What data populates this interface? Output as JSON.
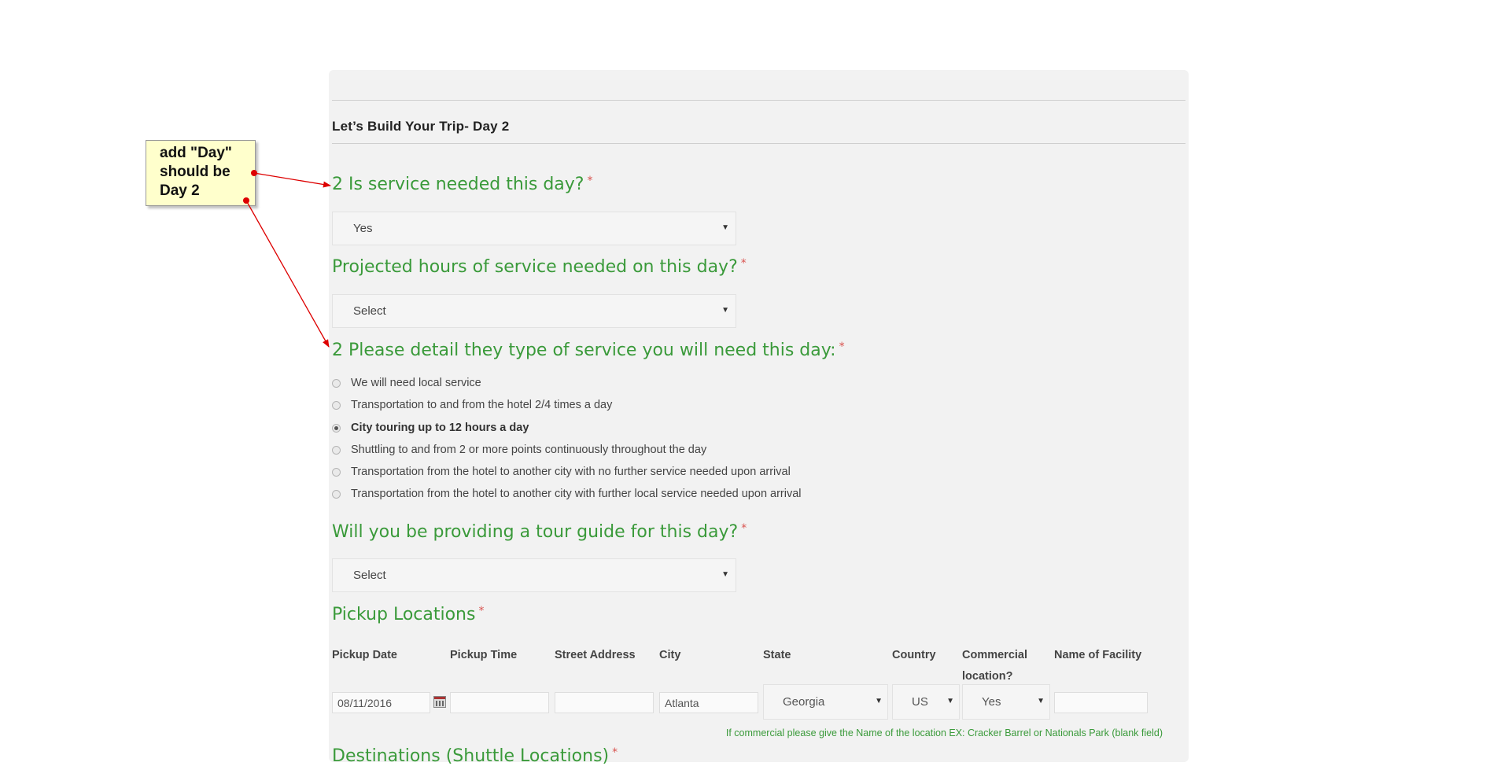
{
  "form": {
    "section_title": "Let’s Build Your Trip- Day 2",
    "q_service": {
      "label": "2 Is service needed this day?",
      "req": "*",
      "value": "Yes"
    },
    "q_hours": {
      "label": "Projected hours of service needed on this day?",
      "req": "*",
      "value": "Select"
    },
    "q_type": {
      "label": "2 Please detail they type of service you will need this day:",
      "req": "*",
      "options": [
        {
          "label": "We will need local service",
          "selected": false
        },
        {
          "label": "Transportation to and from the hotel 2/4 times a day",
          "selected": false
        },
        {
          "label": "City touring up to 12 hours a day",
          "selected": true
        },
        {
          "label": "Shuttling to and from 2 or more points continuously throughout the day",
          "selected": false
        },
        {
          "label": "Transportation from the hotel to another city with no further service needed upon arrival",
          "selected": false
        },
        {
          "label": "Transportation from the hotel to another city with further local service needed upon arrival",
          "selected": false
        }
      ]
    },
    "q_guide": {
      "label": "Will you be providing a tour guide for this day?",
      "req": "*",
      "value": "Select"
    },
    "pickup": {
      "label": "Pickup Locations",
      "req": "*",
      "columns": [
        "Pickup Date",
        "Pickup Time",
        "Street Address",
        "City",
        "State",
        "Country",
        "Commercial location?",
        "Name of Facility"
      ],
      "row": {
        "date": "08/11/2016",
        "time": "",
        "street": "",
        "city": "Atlanta",
        "state": "Georgia",
        "country": "US",
        "commercial": "Yes",
        "facility": ""
      },
      "note": "If commercial please give the Name of the location EX: Cracker Barrel or Nationals Park (blank field)"
    },
    "next_section": {
      "label": "Destinations (Shuttle Locations)",
      "req": "*"
    }
  },
  "annotation": {
    "text": "add \"Day\" should be Day 2",
    "lines": [
      "add \"Day\"",
      "should be",
      "Day 2"
    ]
  },
  "colors": {
    "question_green": "#3a9a3a",
    "required_red": "#d9534f",
    "panel_bg": "#f2f2f2",
    "callout_bg": "#ffffcc",
    "arrow_red": "#dd0000"
  }
}
